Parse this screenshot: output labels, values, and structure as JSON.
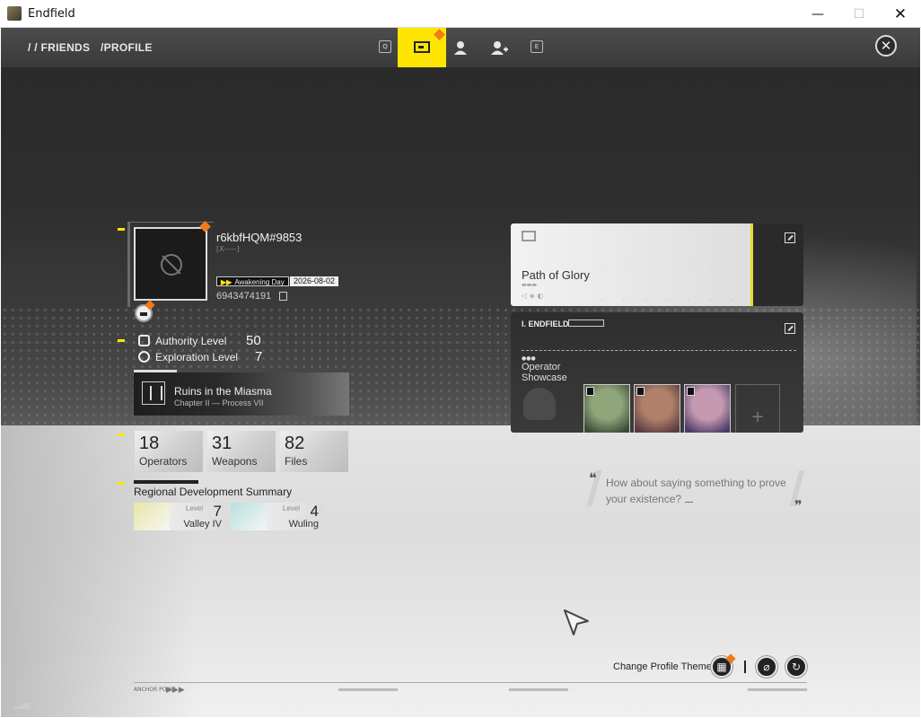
{
  "window": {
    "title": "Endfield",
    "controls": {
      "minimize": "—",
      "maximize": "☐",
      "close": "✕"
    }
  },
  "nav": {
    "breadcrumb": [
      "/ / FRIENDS",
      "/PROFILE"
    ],
    "key_left": "Q",
    "key_right": "E",
    "tabs": [
      {
        "icon": "profile-card-icon",
        "active": true
      },
      {
        "icon": "person-icon",
        "active": false
      },
      {
        "icon": "add-friend-icon",
        "active": false
      }
    ],
    "close_icon": "close-icon"
  },
  "profile": {
    "username": "r6kbfHQM#9853",
    "subline": "[X-----]",
    "awakening_label": "Awakening Day",
    "awakening_date": "2026-08-02",
    "uid": "6943474191",
    "authority_label": "Authority Level",
    "authority_value": "50",
    "exploration_label": "Exploration Level",
    "exploration_value": "7",
    "mission_title": "Ruins in the Miasma",
    "mission_sub": "Chapter II — Process VII"
  },
  "stats": [
    {
      "value": "18",
      "label": "Operators"
    },
    {
      "value": "31",
      "label": "Weapons"
    },
    {
      "value": "82",
      "label": "Files"
    }
  ],
  "regions": {
    "title": "Regional Development Summary",
    "items": [
      {
        "level_label": "Level",
        "level": "7",
        "name": "Valley IV",
        "color": "#e9e6a6"
      },
      {
        "level_label": "Level",
        "level": "4",
        "name": "Wuling",
        "color": "#b9e0de"
      }
    ]
  },
  "glory": {
    "title": "Path of Glory"
  },
  "showcase": {
    "header": "I. ENDFIELD",
    "label_line1": "Operator",
    "label_line2": "Showcase",
    "operators": [
      {
        "num": "01",
        "colors": [
          "#8fa57a",
          "#3c4a36"
        ]
      },
      {
        "num": "01",
        "colors": [
          "#b0806a",
          "#5a3a40"
        ]
      },
      {
        "num": "01",
        "colors": [
          "#c59ab0",
          "#4c3a68"
        ]
      }
    ],
    "empty_slot": "+"
  },
  "quote": {
    "text": "How about saying something to prove your existence?"
  },
  "footer": {
    "change_theme": "Change Profile Theme",
    "anchor_point": "ANCHOR POINT",
    "ping": "167ms"
  },
  "colors": {
    "accent": "#ffe600",
    "notice": "#f07a1c"
  }
}
